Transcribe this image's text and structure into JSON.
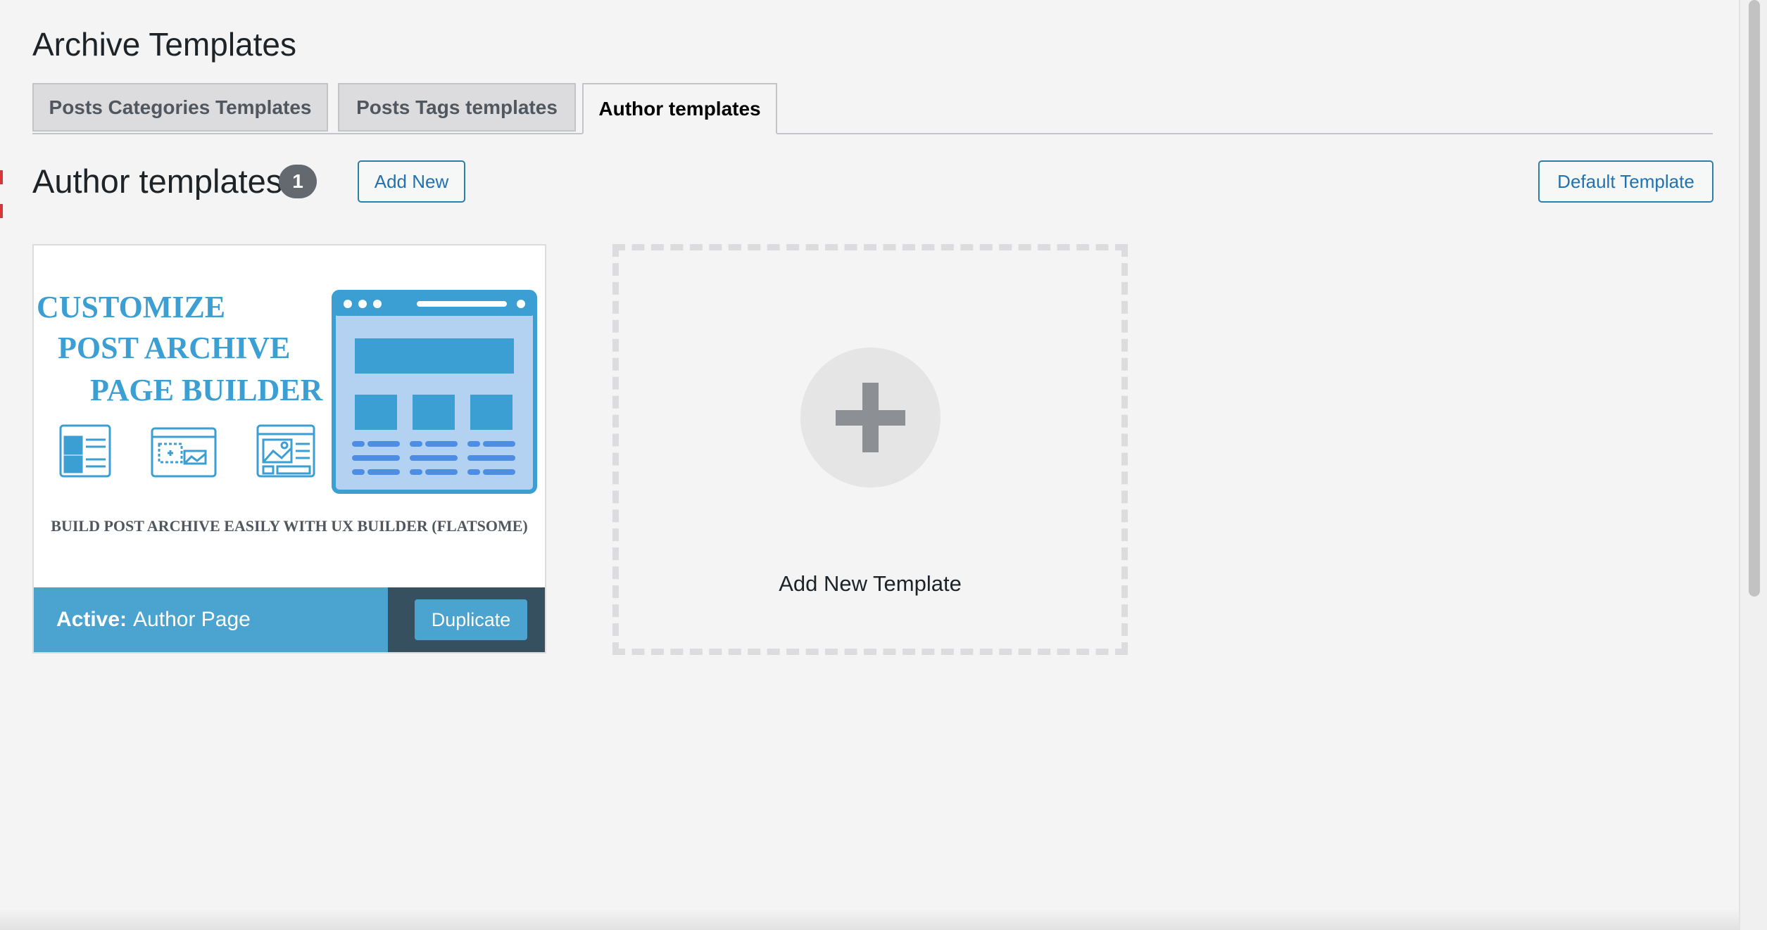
{
  "page": {
    "title": "Archive Templates"
  },
  "tabs": [
    {
      "label": "Posts Categories Templates",
      "active": false
    },
    {
      "label": "Posts Tags templates",
      "active": false
    },
    {
      "label": "Author templates",
      "active": true
    }
  ],
  "section": {
    "title": "Author templates",
    "count": "1",
    "add_new_label": "Add New",
    "default_template_label": "Default Template"
  },
  "template_card": {
    "preview": {
      "headline": [
        "CUSTOMIZE",
        "POST ARCHIVE",
        "PAGE BUILDER"
      ],
      "tagline": "BUILD POST ARCHIVE EASILY WITH UX BUILDER (FLATSOME)"
    },
    "status_prefix": "Active:",
    "name": "Author Page",
    "duplicate_label": "Duplicate"
  },
  "add_new_card": {
    "label": "Add New Template",
    "icon": "plus-icon"
  },
  "colors": {
    "accent": "#2271b1",
    "footer_blue": "#4ba3cf",
    "footer_dark": "#36505f",
    "preview_blue": "#3c9fd3",
    "badge": "#646970"
  }
}
